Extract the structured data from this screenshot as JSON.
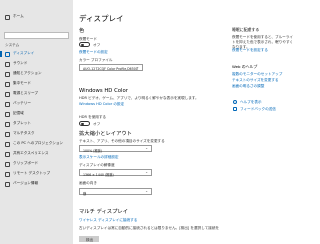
{
  "sidebar": {
    "home": "ホーム",
    "section": "システム",
    "items": [
      {
        "label": "ディスプレイ",
        "active": true
      },
      {
        "label": "サウンド"
      },
      {
        "label": "通知とアクション"
      },
      {
        "label": "集中モード"
      },
      {
        "label": "電源とスリープ"
      },
      {
        "label": "バッテリー"
      },
      {
        "label": "記憶域"
      },
      {
        "label": "タブレット"
      },
      {
        "label": "マルチタスク"
      },
      {
        "label": "この PC へのプロジェクション"
      },
      {
        "label": "共有エクスペリエンス"
      },
      {
        "label": "クリップボード"
      },
      {
        "label": "リモート デスクトップ"
      },
      {
        "label": "バージョン情報"
      }
    ]
  },
  "main": {
    "title": "ディスプレイ",
    "color_heading": "色",
    "night_light_label": "夜間モード",
    "night_light_state": "オフ",
    "night_light_settings_link": "夜間モードの設定",
    "color_profile_label": "カラー プロファイル",
    "color_profile_value": "AUO-1272CQF Color Profile,D6500",
    "hdr_heading": "Windows HD Color",
    "hdr_description": "HDR ビデオ、ゲーム、アプリで、より明るく鮮やかな表示を実現します。",
    "hdr_settings_link": "Windows HD Color の設定",
    "hdr_toggle_label": "HDR を使用する",
    "hdr_state": "オフ",
    "scale_heading": "拡大縮小とレイアウト",
    "scale_label": "テキスト、アプリ、その他の項目のサイズを変更する",
    "scale_value": "100% (推奨)",
    "advanced_scale_link": "表示スケールの詳細設定",
    "resolution_label": "ディスプレイの解像度",
    "resolution_value": "1366 × 1440 (推奨)",
    "orientation_label": "画面の向き",
    "orientation_value": "横",
    "multi_heading": "マルチ ディスプレイ",
    "multi_link": "ワイヤレス ディスプレイに接続する",
    "multi_description": "古いディスプレイは常に自動的に接続されるとは限りません。[検出] を選択して接続を試してください。",
    "detect_button": "検出"
  },
  "right": {
    "sleep_heading": "睡眠に配慮する",
    "sleep_text": "夜間モードを使用すると、ブルーライトを抑えた色で表示され、眠りやすくなります。",
    "sleep_link": "夜間モードを設定する",
    "web_heading": "Web のヘルプ",
    "web_links": [
      "複数のモニターのセットアップ",
      "テキストのサイズを変更する",
      "画面の明るさの調整"
    ],
    "help_link": "ヘルプを表示",
    "feedback_link": "フィードバックの送信"
  }
}
